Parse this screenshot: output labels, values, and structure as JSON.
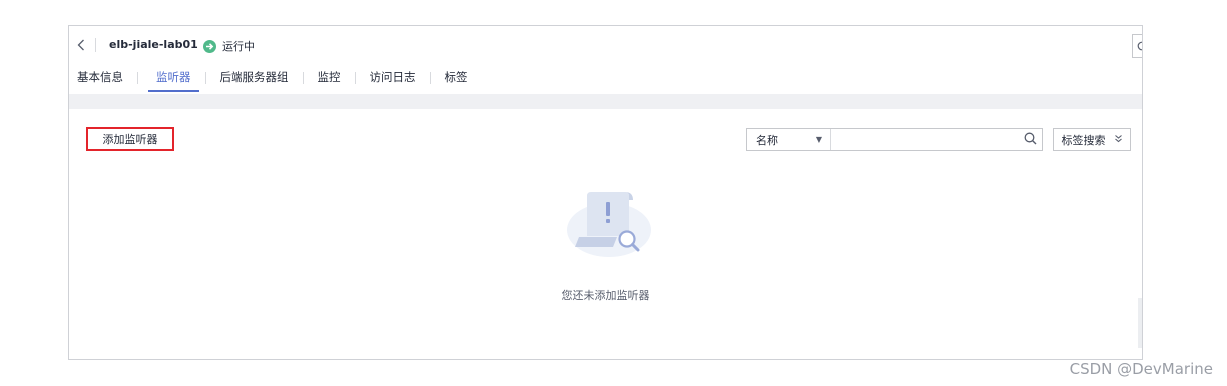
{
  "header": {
    "elb_name": "elb-jiale-lab01",
    "status_text": "运行中",
    "status_color": "#50b98a"
  },
  "tabs": [
    {
      "label": "基本信息",
      "active": false
    },
    {
      "label": "监听器",
      "active": true
    },
    {
      "label": "后端服务器组",
      "active": false
    },
    {
      "label": "监控",
      "active": false
    },
    {
      "label": "访问日志",
      "active": false
    },
    {
      "label": "标签",
      "active": false
    }
  ],
  "toolbar": {
    "add_listener_label": "添加监听器",
    "highlight_color": "#e3242b",
    "search_field_select": "名称",
    "search_value": "",
    "tag_search_label": "标签搜索"
  },
  "empty_state": {
    "message": "您还未添加监听器",
    "icon": "empty-document-search-icon"
  },
  "watermark": "CSDN @DevMarine",
  "colors": {
    "accent": "#526ecc",
    "border": "#c6c8cc"
  }
}
